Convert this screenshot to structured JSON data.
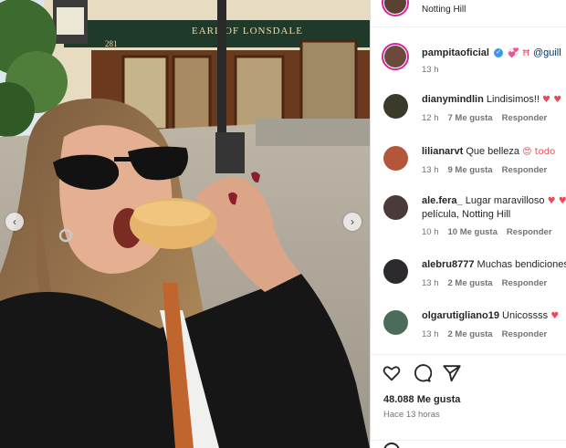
{
  "photo": {
    "sign_number": "281",
    "sign_text": "EARL OF LONSDALE",
    "prev_label": "‹",
    "next_label": "›"
  },
  "header": {
    "location": "Notting Hill"
  },
  "caption": {
    "username": "pampitaoficial",
    "verified_mark": "✓",
    "emojis": "💞 Ħ",
    "mention": "@guill",
    "time": "13 h"
  },
  "comments": [
    {
      "username": "dianymindlin",
      "text": "Lindisimos!!",
      "emoji": "♥ ♥",
      "line2": "",
      "time": "12 h",
      "likes": "7 Me gusta",
      "reply": "Responder",
      "avatar_color": "#3b3a2a"
    },
    {
      "username": "lilianarvt",
      "text": "Que belleza",
      "emoji": "😍 todo",
      "line2": "",
      "time": "13 h",
      "likes": "9 Me gusta",
      "reply": "Responder",
      "avatar_color": "#b4563b"
    },
    {
      "username": "ale.fera_",
      "text": "Lugar maravilloso",
      "emoji": "♥ ♥",
      "line2": "película, Notting Hill",
      "time": "10 h",
      "likes": "10 Me gusta",
      "reply": "Responder",
      "avatar_color": "#4a3a3a"
    },
    {
      "username": "alebru8777",
      "text": "Muchas bendiciones",
      "emoji": "",
      "line2": "",
      "time": "13 h",
      "likes": "2 Me gusta",
      "reply": "Responder",
      "avatar_color": "#2d2a2e"
    },
    {
      "username": "olgarutigliano19",
      "text": "Únicossss",
      "emoji": "♥",
      "line2": "",
      "time": "13 h",
      "likes": "2 Me gusta",
      "reply": "Responder",
      "avatar_color": "#4d6b5a"
    }
  ],
  "actions": {
    "like_icon": "heart-outline-icon",
    "comment_icon": "comment-bubble-icon",
    "share_icon": "paper-plane-icon",
    "likes_count": "48.088 Me gusta",
    "posted_ago": "Hace 13 horas"
  },
  "colors": {
    "verified": "#3897f0",
    "heart": "#ed4956",
    "story_ring": "#d6249f",
    "pub_green": "#1f3a2b"
  }
}
